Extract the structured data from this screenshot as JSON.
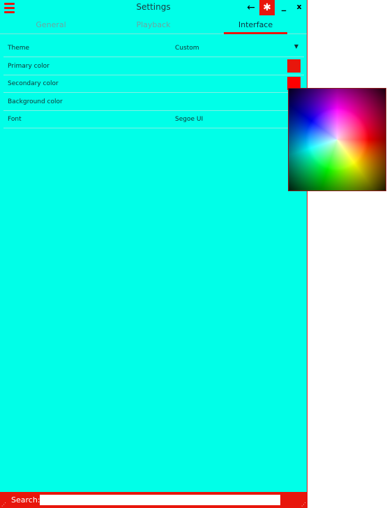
{
  "window": {
    "title": "Settings",
    "accent": "#e8160c",
    "background": "#00ffe8"
  },
  "titlebar": {
    "menu_icon": "hamburger-icon",
    "back_icon": "←",
    "settings_icon": "✱",
    "minimize": "_",
    "close": "x"
  },
  "tabs": [
    {
      "label": "General"
    },
    {
      "label": "Playback"
    },
    {
      "label": "Interface"
    }
  ],
  "active_tab": "Interface",
  "settings": {
    "theme": {
      "label": "Theme",
      "value": "Custom",
      "dropdown": "▼"
    },
    "primary_color": {
      "label": "Primary color",
      "color": "#e8160c"
    },
    "secondary_color": {
      "label": "Secondary color",
      "color": "#ff0000"
    },
    "background_color": {
      "label": "Background color"
    },
    "font": {
      "label": "Font",
      "value": "Segoe UI"
    }
  },
  "search": {
    "label": "Search:",
    "value": "",
    "placeholder": ""
  }
}
